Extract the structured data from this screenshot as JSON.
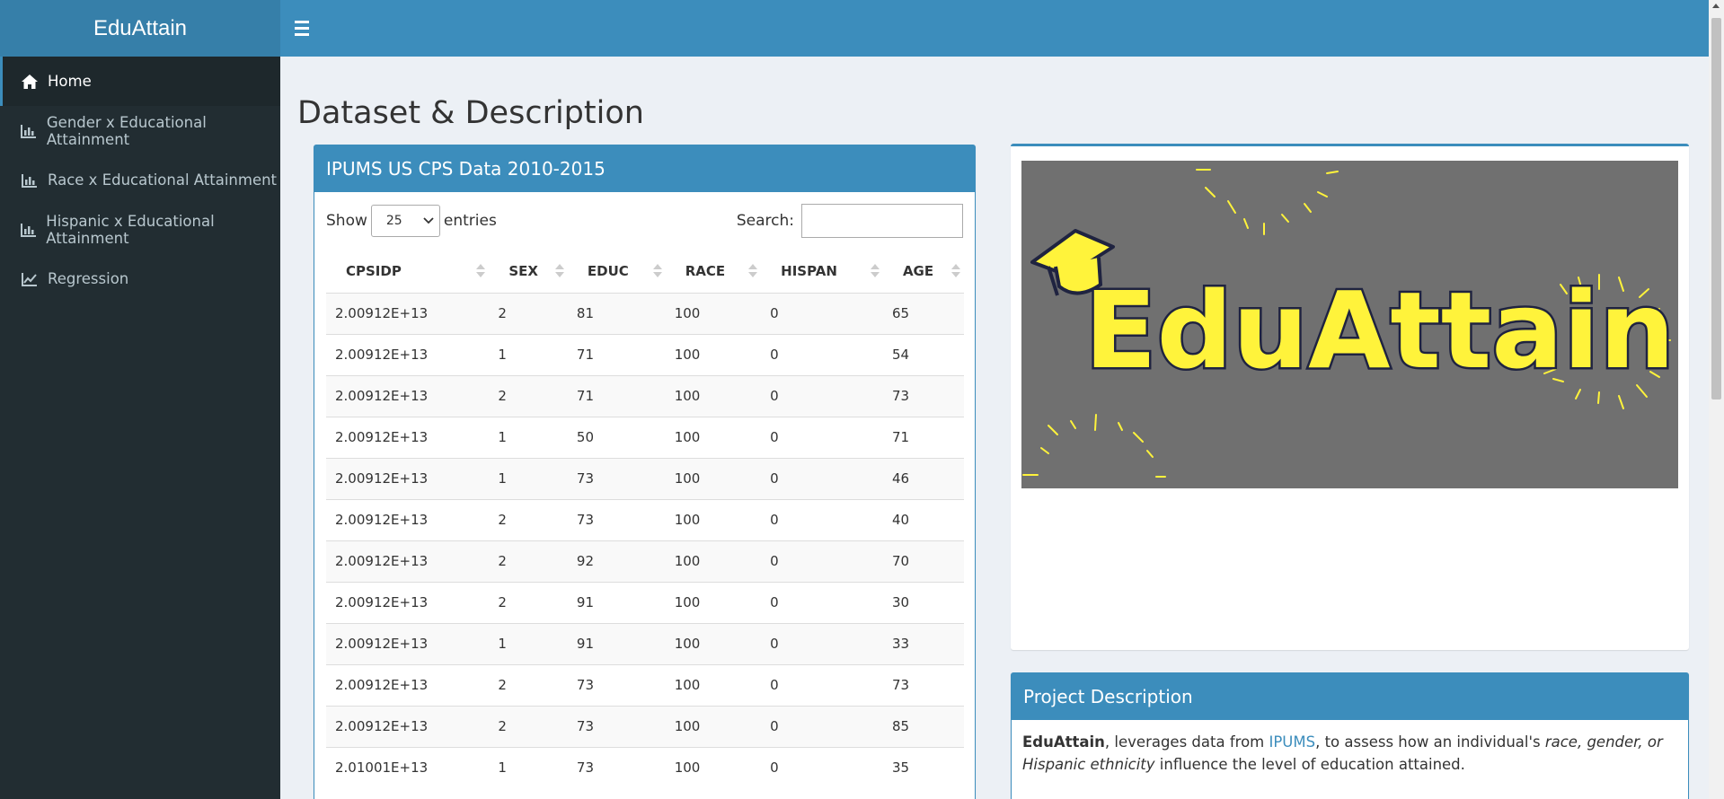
{
  "app": {
    "title": "EduAttain"
  },
  "sidebar": {
    "items": [
      {
        "label": "Home",
        "icon": "home-icon"
      },
      {
        "label": "Gender x Educational Attainment",
        "icon": "bar-chart-icon"
      },
      {
        "label": "Race x Educational Attainment",
        "icon": "bar-chart-icon"
      },
      {
        "label": "Hispanic x Educational Attainment",
        "icon": "bar-chart-icon"
      },
      {
        "label": "Regression",
        "icon": "line-chart-icon"
      }
    ]
  },
  "page": {
    "title": "Dataset & Description"
  },
  "table_box": {
    "title": "IPUMS US CPS Data 2010-2015",
    "show_label": "Show",
    "entries_value": "25",
    "entries_label": "entries",
    "search_label": "Search:",
    "columns": [
      "CPSIDP",
      "SEX",
      "EDUC",
      "RACE",
      "HISPAN",
      "AGE"
    ],
    "rows": [
      [
        "2.00912E+13",
        "2",
        "81",
        "100",
        "0",
        "65"
      ],
      [
        "2.00912E+13",
        "1",
        "71",
        "100",
        "0",
        "54"
      ],
      [
        "2.00912E+13",
        "2",
        "71",
        "100",
        "0",
        "73"
      ],
      [
        "2.00912E+13",
        "1",
        "50",
        "100",
        "0",
        "71"
      ],
      [
        "2.00912E+13",
        "1",
        "73",
        "100",
        "0",
        "46"
      ],
      [
        "2.00912E+13",
        "2",
        "73",
        "100",
        "0",
        "40"
      ],
      [
        "2.00912E+13",
        "2",
        "92",
        "100",
        "0",
        "70"
      ],
      [
        "2.00912E+13",
        "2",
        "91",
        "100",
        "0",
        "30"
      ],
      [
        "2.00912E+13",
        "1",
        "91",
        "100",
        "0",
        "33"
      ],
      [
        "2.00912E+13",
        "2",
        "73",
        "100",
        "0",
        "73"
      ],
      [
        "2.00912E+13",
        "2",
        "73",
        "100",
        "0",
        "85"
      ],
      [
        "2.01001E+13",
        "1",
        "73",
        "100",
        "0",
        "35"
      ]
    ]
  },
  "banner": {
    "logo_text": "EduAttain",
    "bg_color": "#707070",
    "text_color": "#fff33b"
  },
  "description_box": {
    "title": "Project Description",
    "brand": "EduAttain",
    "text_1": ", leverages data from ",
    "link": "IPUMS",
    "text_2": ", to assess how an individual's ",
    "italic": "race, gender, or Hispanic ethnicity",
    "text_3": " influence the level of education attained."
  },
  "colors": {
    "primary": "#3c8dbc",
    "logo_bar": "#367fa9",
    "sidebar": "#222d32"
  }
}
